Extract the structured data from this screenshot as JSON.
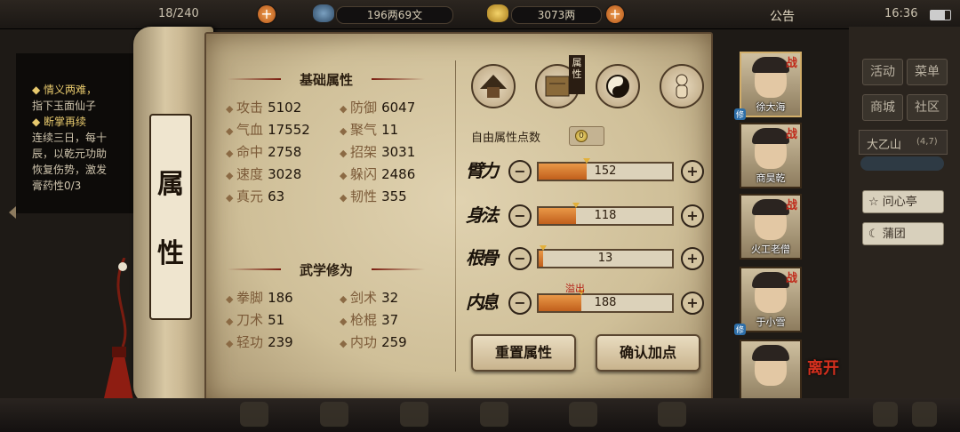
{
  "topbar": {
    "left_count_fragment": "18/240",
    "copper": "196两69文",
    "silver": "3073两",
    "notice_label": "公告",
    "time": "16:36"
  },
  "quests": [
    {
      "text": "◆ 情义两难，",
      "head": true
    },
    {
      "text": "指下玉面仙子",
      "head": false
    },
    {
      "text": "◆ 断掌再续",
      "head": true
    },
    {
      "text": "连续三日，每十",
      "head": false
    },
    {
      "text": "辰，以乾元功助",
      "head": false
    },
    {
      "text": "恢复伤势，激发",
      "head": false
    },
    {
      "text": "膏药性0/3",
      "head": false
    }
  ],
  "scroll_title": [
    "属",
    "性"
  ],
  "basic": {
    "title": "基础属性",
    "stats": [
      {
        "label": "攻击",
        "value": "5102"
      },
      {
        "label": "防御",
        "value": "6047"
      },
      {
        "label": "气血",
        "value": "17552"
      },
      {
        "label": "聚气",
        "value": "11"
      },
      {
        "label": "命中",
        "value": "2758"
      },
      {
        "label": "招架",
        "value": "3031"
      },
      {
        "label": "速度",
        "value": "3028"
      },
      {
        "label": "躲闪",
        "value": "2486"
      },
      {
        "label": "真元",
        "value": "63"
      },
      {
        "label": "韧性",
        "value": "355"
      }
    ]
  },
  "martial": {
    "title": "武学修为",
    "stats": [
      {
        "label": "拳脚",
        "value": "186"
      },
      {
        "label": "剑术",
        "value": "32"
      },
      {
        "label": "刀术",
        "value": "51"
      },
      {
        "label": "枪棍",
        "value": "37"
      },
      {
        "label": "轻功",
        "value": "239"
      },
      {
        "label": "内功",
        "value": "259"
      }
    ]
  },
  "tab_badge": "属性",
  "free_points": {
    "label": "自由属性点数",
    "value": "0"
  },
  "allocations": [
    {
      "name": "臂力",
      "value": "152",
      "fill": 0.36
    },
    {
      "name": "身法",
      "value": "118",
      "fill": 0.28
    },
    {
      "name": "根骨",
      "value": "13",
      "fill": 0.03
    },
    {
      "name": "内息",
      "value": "188",
      "fill": 0.32
    }
  ],
  "overflow_label": "溢出",
  "buttons": {
    "reset": "重置属性",
    "confirm": "确认加点"
  },
  "characters": [
    {
      "name": "徐大海",
      "zhan": "战",
      "xiu": "修"
    },
    {
      "name": "商昊乾",
      "zhan": "战",
      "xiu": ""
    },
    {
      "name": "火工老僧",
      "zhan": "战",
      "xiu": ""
    },
    {
      "name": "于小雪",
      "zhan": "战",
      "xiu": "修"
    },
    {
      "name": "",
      "zhan": "",
      "xiu": ""
    }
  ],
  "leave_label": "离开",
  "right_panel": {
    "activity": "活动",
    "menu": "菜单",
    "shop": "商城",
    "community": "社区",
    "location": "大乙山",
    "location_coord": "(4,7)",
    "list": [
      "问心亭",
      "蒲团"
    ]
  },
  "colors": {
    "accent": "#c15f1c",
    "title_red": "#c0291a",
    "paper": "#d6c8a6"
  }
}
